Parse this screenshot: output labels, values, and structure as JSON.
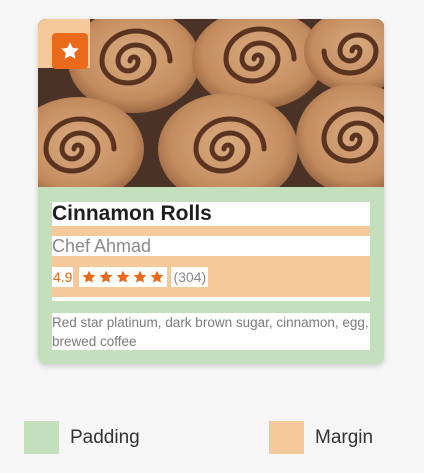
{
  "card": {
    "title": "Cinnamon Rolls",
    "chef": "Chef Ahmad",
    "rating": "4.9",
    "stars": 5,
    "review_count": "(304)",
    "description": "Red star platinum, dark brown sugar, cinnamon, egg, brewed coffee",
    "badge_icon": "star-icon",
    "image": "cinnamon-rolls-photo",
    "accent_color": "#ea6a1c"
  },
  "legend": {
    "padding_label": "Padding",
    "padding_color": "#c3dfbc",
    "margin_label": "Margin",
    "margin_color": "#f5c999"
  }
}
